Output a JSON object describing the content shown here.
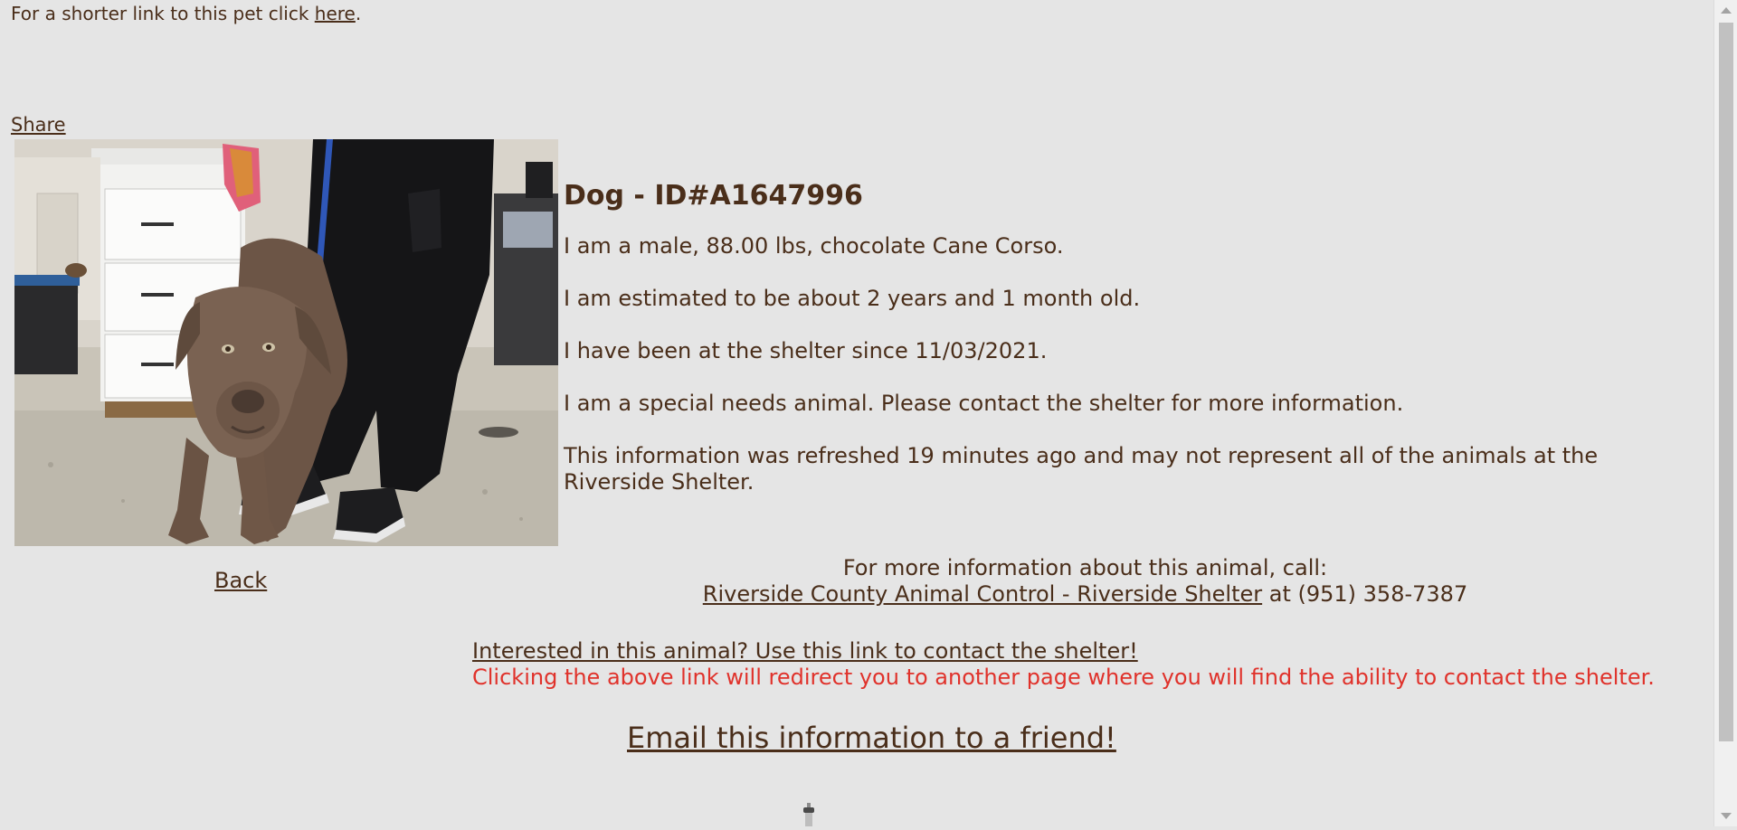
{
  "header": {
    "short_link_prefix": "For a shorter link to this pet click ",
    "short_link_text": "here",
    "short_link_suffix": "."
  },
  "share_label": "Share",
  "back_label": "Back",
  "animal": {
    "title": "Dog - ID#A1647996",
    "description": "I am a male, 88.00 lbs, chocolate Cane Corso.",
    "age": "I am estimated to be about 2 years and 1 month old.",
    "since": "I have been at the shelter since 11/03/2021.",
    "special_needs": "I am a special needs animal. Please contact the shelter for more information.",
    "refresh_note": "This information was refreshed 19 minutes ago and may not represent all of the animals at the Riverside Shelter."
  },
  "contact": {
    "call_intro": "For more information about this animal, call:",
    "shelter_name": "Riverside County Animal Control - Riverside Shelter",
    "at_text": " at ",
    "phone": "(951) 358-7387",
    "interest_link": "Interested in this animal? Use this link to contact the shelter!",
    "redirect_note": "Clicking the above link will redirect you to another page where you will find the ability to contact the shelter."
  },
  "email_label": "Email this information to a friend!",
  "colors": {
    "background": "#e5e5e5",
    "text": "#4a2e1a",
    "warning": "#e0322b"
  },
  "icons": {
    "pet_photo": "dog-photo",
    "loading": "loading-spinner-icon"
  }
}
